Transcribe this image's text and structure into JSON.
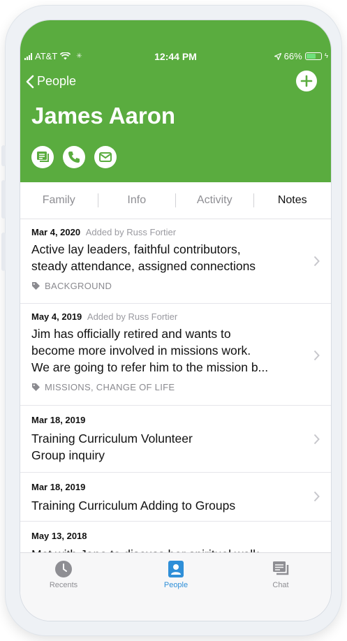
{
  "status_bar": {
    "carrier": "AT&T",
    "time": "12:44 PM",
    "battery": "66%",
    "battery_level": 0.66
  },
  "nav": {
    "back_label": "People"
  },
  "person": {
    "name": "James Aaron"
  },
  "tabs": [
    {
      "label": "Family",
      "active": false
    },
    {
      "label": "Info",
      "active": false
    },
    {
      "label": "Activity",
      "active": false
    },
    {
      "label": "Notes",
      "active": true
    }
  ],
  "notes": [
    {
      "date": "Mar 4, 2020",
      "author": "Added by Russ Fortier",
      "lines": [
        "Active lay leaders, faithful contributors,",
        "steady attendance, assigned connections"
      ],
      "tags": "BACKGROUND"
    },
    {
      "date": "May 4, 2019",
      "author": "Added by Russ Fortier",
      "lines": [
        "Jim has officially retired and wants to",
        "become more involved in missions work.",
        "We are going to refer him to the mission b..."
      ],
      "tags": "MISSIONS, CHANGE OF LIFE"
    },
    {
      "date": "Mar 18, 2019",
      "author": "",
      "lines": [
        "Training Curriculum Volunteer",
        "Group inquiry"
      ],
      "tags": ""
    },
    {
      "date": "Mar 18, 2019",
      "author": "",
      "lines": [
        "Training Curriculum Adding to Groups"
      ],
      "tags": ""
    },
    {
      "date": "May 13, 2018",
      "author": "",
      "lines": [
        "Met with Jane to discuss her spiritual walk."
      ],
      "tags": ""
    }
  ],
  "tabbar": [
    {
      "label": "Recents",
      "icon": "clock-icon",
      "active": false
    },
    {
      "label": "People",
      "icon": "person-icon",
      "active": true
    },
    {
      "label": "Chat",
      "icon": "chat-icon",
      "active": false
    }
  ],
  "colors": {
    "brand_green": "#5aac3f",
    "active_blue": "#2f8fd8"
  }
}
